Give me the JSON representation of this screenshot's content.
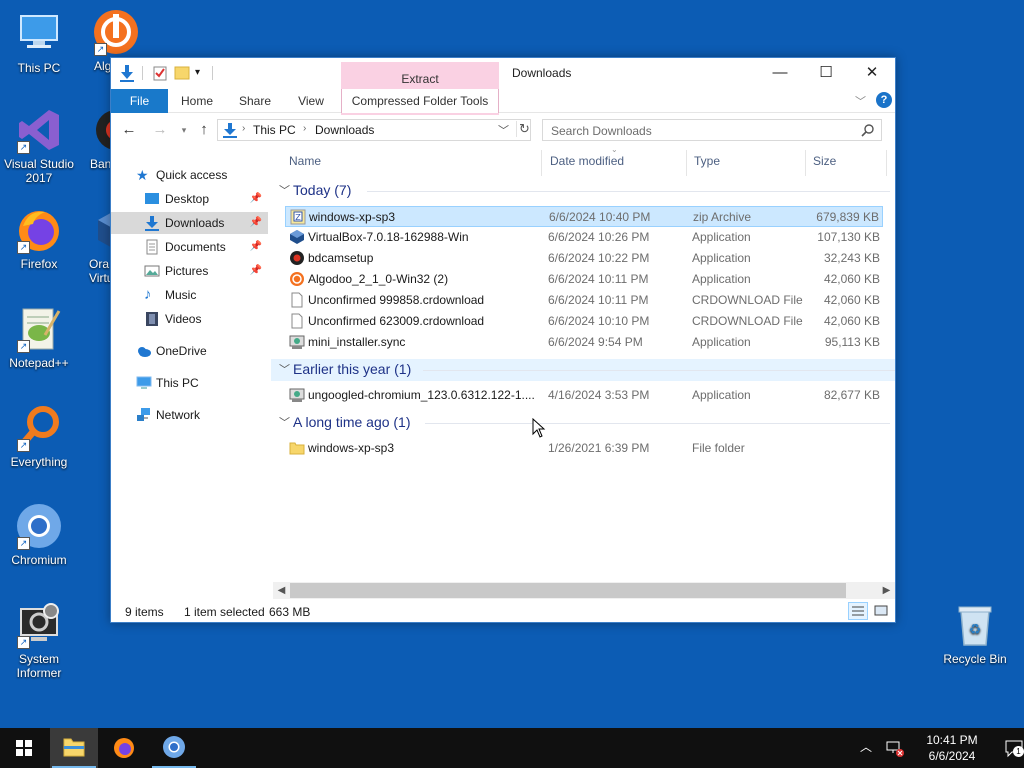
{
  "desktop": {
    "icons": [
      {
        "label": "This PC"
      },
      {
        "label": "Alg"
      },
      {
        "label": "Visual Studio 2017"
      },
      {
        "label": "Ban"
      },
      {
        "label": "Firefox"
      },
      {
        "label": "Ora Virtu"
      },
      {
        "label": "Notepad++"
      },
      {
        "label": "Everything"
      },
      {
        "label": "Chromium"
      },
      {
        "label": "System Informer"
      },
      {
        "label": "Recycle Bin"
      }
    ]
  },
  "window": {
    "title": "Downloads",
    "context_tab": "Extract",
    "controls": {
      "minimize": "—",
      "maximize": "☐",
      "close": "✕"
    }
  },
  "ribbon": {
    "tabs": [
      "File",
      "Home",
      "Share",
      "View",
      "Compressed Folder Tools"
    ]
  },
  "address": {
    "breadcrumb": [
      "This PC",
      "Downloads"
    ],
    "search_placeholder": "Search Downloads"
  },
  "nav_pane": {
    "quick_access": "Quick access",
    "items": [
      {
        "label": "Desktop",
        "pinned": true
      },
      {
        "label": "Downloads",
        "pinned": true,
        "selected": true
      },
      {
        "label": "Documents",
        "pinned": true
      },
      {
        "label": "Pictures",
        "pinned": true
      },
      {
        "label": "Music",
        "pinned": false
      },
      {
        "label": "Videos",
        "pinned": false
      }
    ],
    "onedrive": "OneDrive",
    "this_pc": "This PC",
    "network": "Network"
  },
  "columns": {
    "name": "Name",
    "date": "Date modified",
    "type": "Type",
    "size": "Size"
  },
  "groups": [
    {
      "label": "Today (7)",
      "files": [
        {
          "name": "windows-xp-sp3",
          "date": "6/6/2024 10:40 PM",
          "type": "zip Archive",
          "size": "679,839 KB",
          "icon": "zip-archive-icon",
          "selected": true
        },
        {
          "name": "VirtualBox-7.0.18-162988-Win",
          "date": "6/6/2024 10:26 PM",
          "type": "Application",
          "size": "107,130 KB",
          "icon": "virtualbox-icon"
        },
        {
          "name": "bdcamsetup",
          "date": "6/6/2024 10:22 PM",
          "type": "Application",
          "size": "32,243 KB",
          "icon": "bandicam-icon"
        },
        {
          "name": "Algodoo_2_1_0-Win32 (2)",
          "date": "6/6/2024 10:11 PM",
          "type": "Application",
          "size": "42,060 KB",
          "icon": "algodoo-icon"
        },
        {
          "name": "Unconfirmed 999858.crdownload",
          "date": "6/6/2024 10:11 PM",
          "type": "CRDOWNLOAD File",
          "size": "42,060 KB",
          "icon": "blank-file-icon"
        },
        {
          "name": "Unconfirmed 623009.crdownload",
          "date": "6/6/2024 10:10 PM",
          "type": "CRDOWNLOAD File",
          "size": "42,060 KB",
          "icon": "blank-file-icon"
        },
        {
          "name": "mini_installer.sync",
          "date": "6/6/2024 9:54 PM",
          "type": "Application",
          "size": "95,113 KB",
          "icon": "installer-icon"
        }
      ]
    },
    {
      "label": "Earlier this year (1)",
      "files": [
        {
          "name": "ungoogled-chromium_123.0.6312.122-1....",
          "date": "4/16/2024 3:53 PM",
          "type": "Application",
          "size": "82,677 KB",
          "icon": "installer-icon"
        }
      ]
    },
    {
      "label": "A long time ago (1)",
      "files": [
        {
          "name": "windows-xp-sp3",
          "date": "1/26/2021 6:39 PM",
          "type": "File folder",
          "size": "",
          "icon": "folder-icon"
        }
      ]
    }
  ],
  "status": {
    "items": "9 items",
    "selected": "1 item selected",
    "size": "663 MB"
  },
  "taskbar": {
    "time": "10:41 PM",
    "date": "6/6/2024",
    "notification_count": "1"
  }
}
